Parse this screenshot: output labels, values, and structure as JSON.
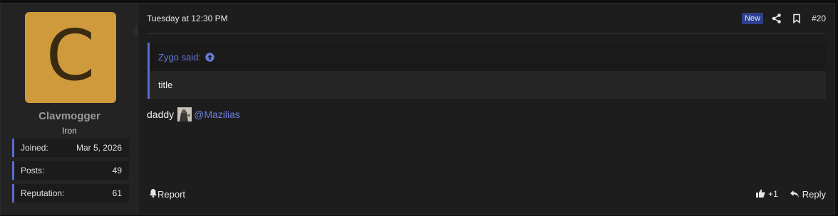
{
  "user": {
    "avatar_letter": "C",
    "avatar_color": "#cf9a3c",
    "name": "Clavmogger",
    "rank": "Iron",
    "stats": [
      {
        "label": "Joined:",
        "value": "Mar 5, 2026"
      },
      {
        "label": "Posts:",
        "value": "49"
      },
      {
        "label": "Reputation:",
        "value": "61"
      }
    ]
  },
  "post": {
    "timestamp": "Tuesday at 12:30 PM",
    "new_badge": "New",
    "number": "#20",
    "quote": {
      "author": "Zygo said:",
      "text": "title"
    },
    "body_text": "daddy",
    "mention": "@Mazilias",
    "report_label": "Report",
    "like_count": "+1",
    "reply_label": "Reply"
  },
  "icons": [
    "share-icon",
    "bookmark-icon",
    "arrow-up-circle-icon",
    "bell-icon",
    "thumbs-up-icon",
    "reply-icon"
  ],
  "colors": {
    "accent": "#5a6bd1",
    "badge": "#2d3f8c",
    "background": "#1d1d1d"
  }
}
